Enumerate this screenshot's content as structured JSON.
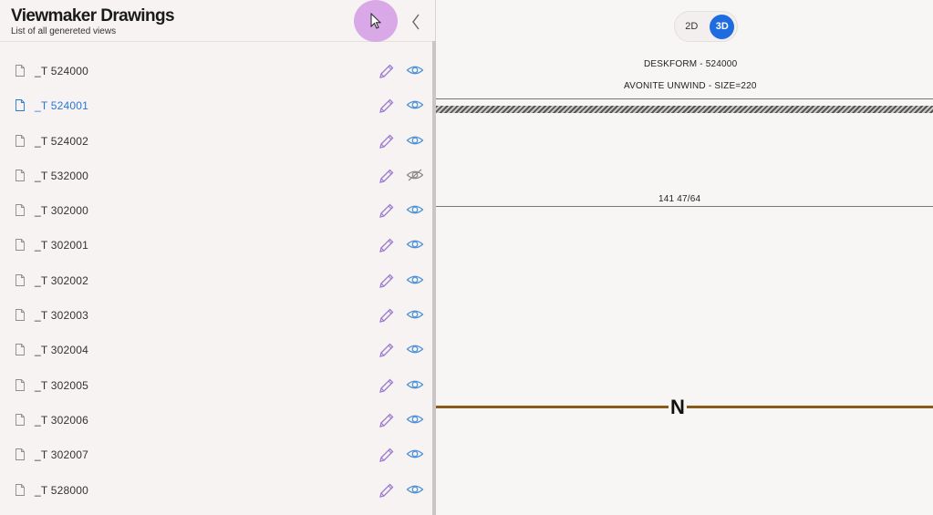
{
  "panel": {
    "title": "Viewmaker Drawings",
    "subtitle": "List of all genereted views"
  },
  "view_toggle": {
    "options": [
      "2D",
      "3D"
    ],
    "selected": "3D"
  },
  "drawing": {
    "title": "DESKFORM - 524000",
    "subtitle": "AVONITE UNWIND - SIZE=220",
    "dimension": "141 47/64",
    "north_label": "N"
  },
  "views": [
    {
      "name": "_T 524000",
      "selected": false,
      "visible": true
    },
    {
      "name": "_T 524001",
      "selected": true,
      "visible": true
    },
    {
      "name": "_T 524002",
      "selected": false,
      "visible": true
    },
    {
      "name": "_T 532000",
      "selected": false,
      "visible": false
    },
    {
      "name": "_T 302000",
      "selected": false,
      "visible": true
    },
    {
      "name": "_T 302001",
      "selected": false,
      "visible": true
    },
    {
      "name": "_T 302002",
      "selected": false,
      "visible": true
    },
    {
      "name": "_T 302003",
      "selected": false,
      "visible": true
    },
    {
      "name": "_T 302004",
      "selected": false,
      "visible": true
    },
    {
      "name": "_T 302005",
      "selected": false,
      "visible": true
    },
    {
      "name": "_T 302006",
      "selected": false,
      "visible": true
    },
    {
      "name": "_T 302007",
      "selected": false,
      "visible": true
    },
    {
      "name": "_T 528000",
      "selected": false,
      "visible": true
    }
  ],
  "colors": {
    "accent": "#1f6be0",
    "selected_text": "#2a78d6",
    "icon_edit": "#9b7ad0",
    "icon_eye": "#4a8fd8",
    "icon_eye_hidden": "#8a8a8a",
    "brown_line": "#8a5a1c",
    "cursor_highlight": "#d9a8e6"
  }
}
